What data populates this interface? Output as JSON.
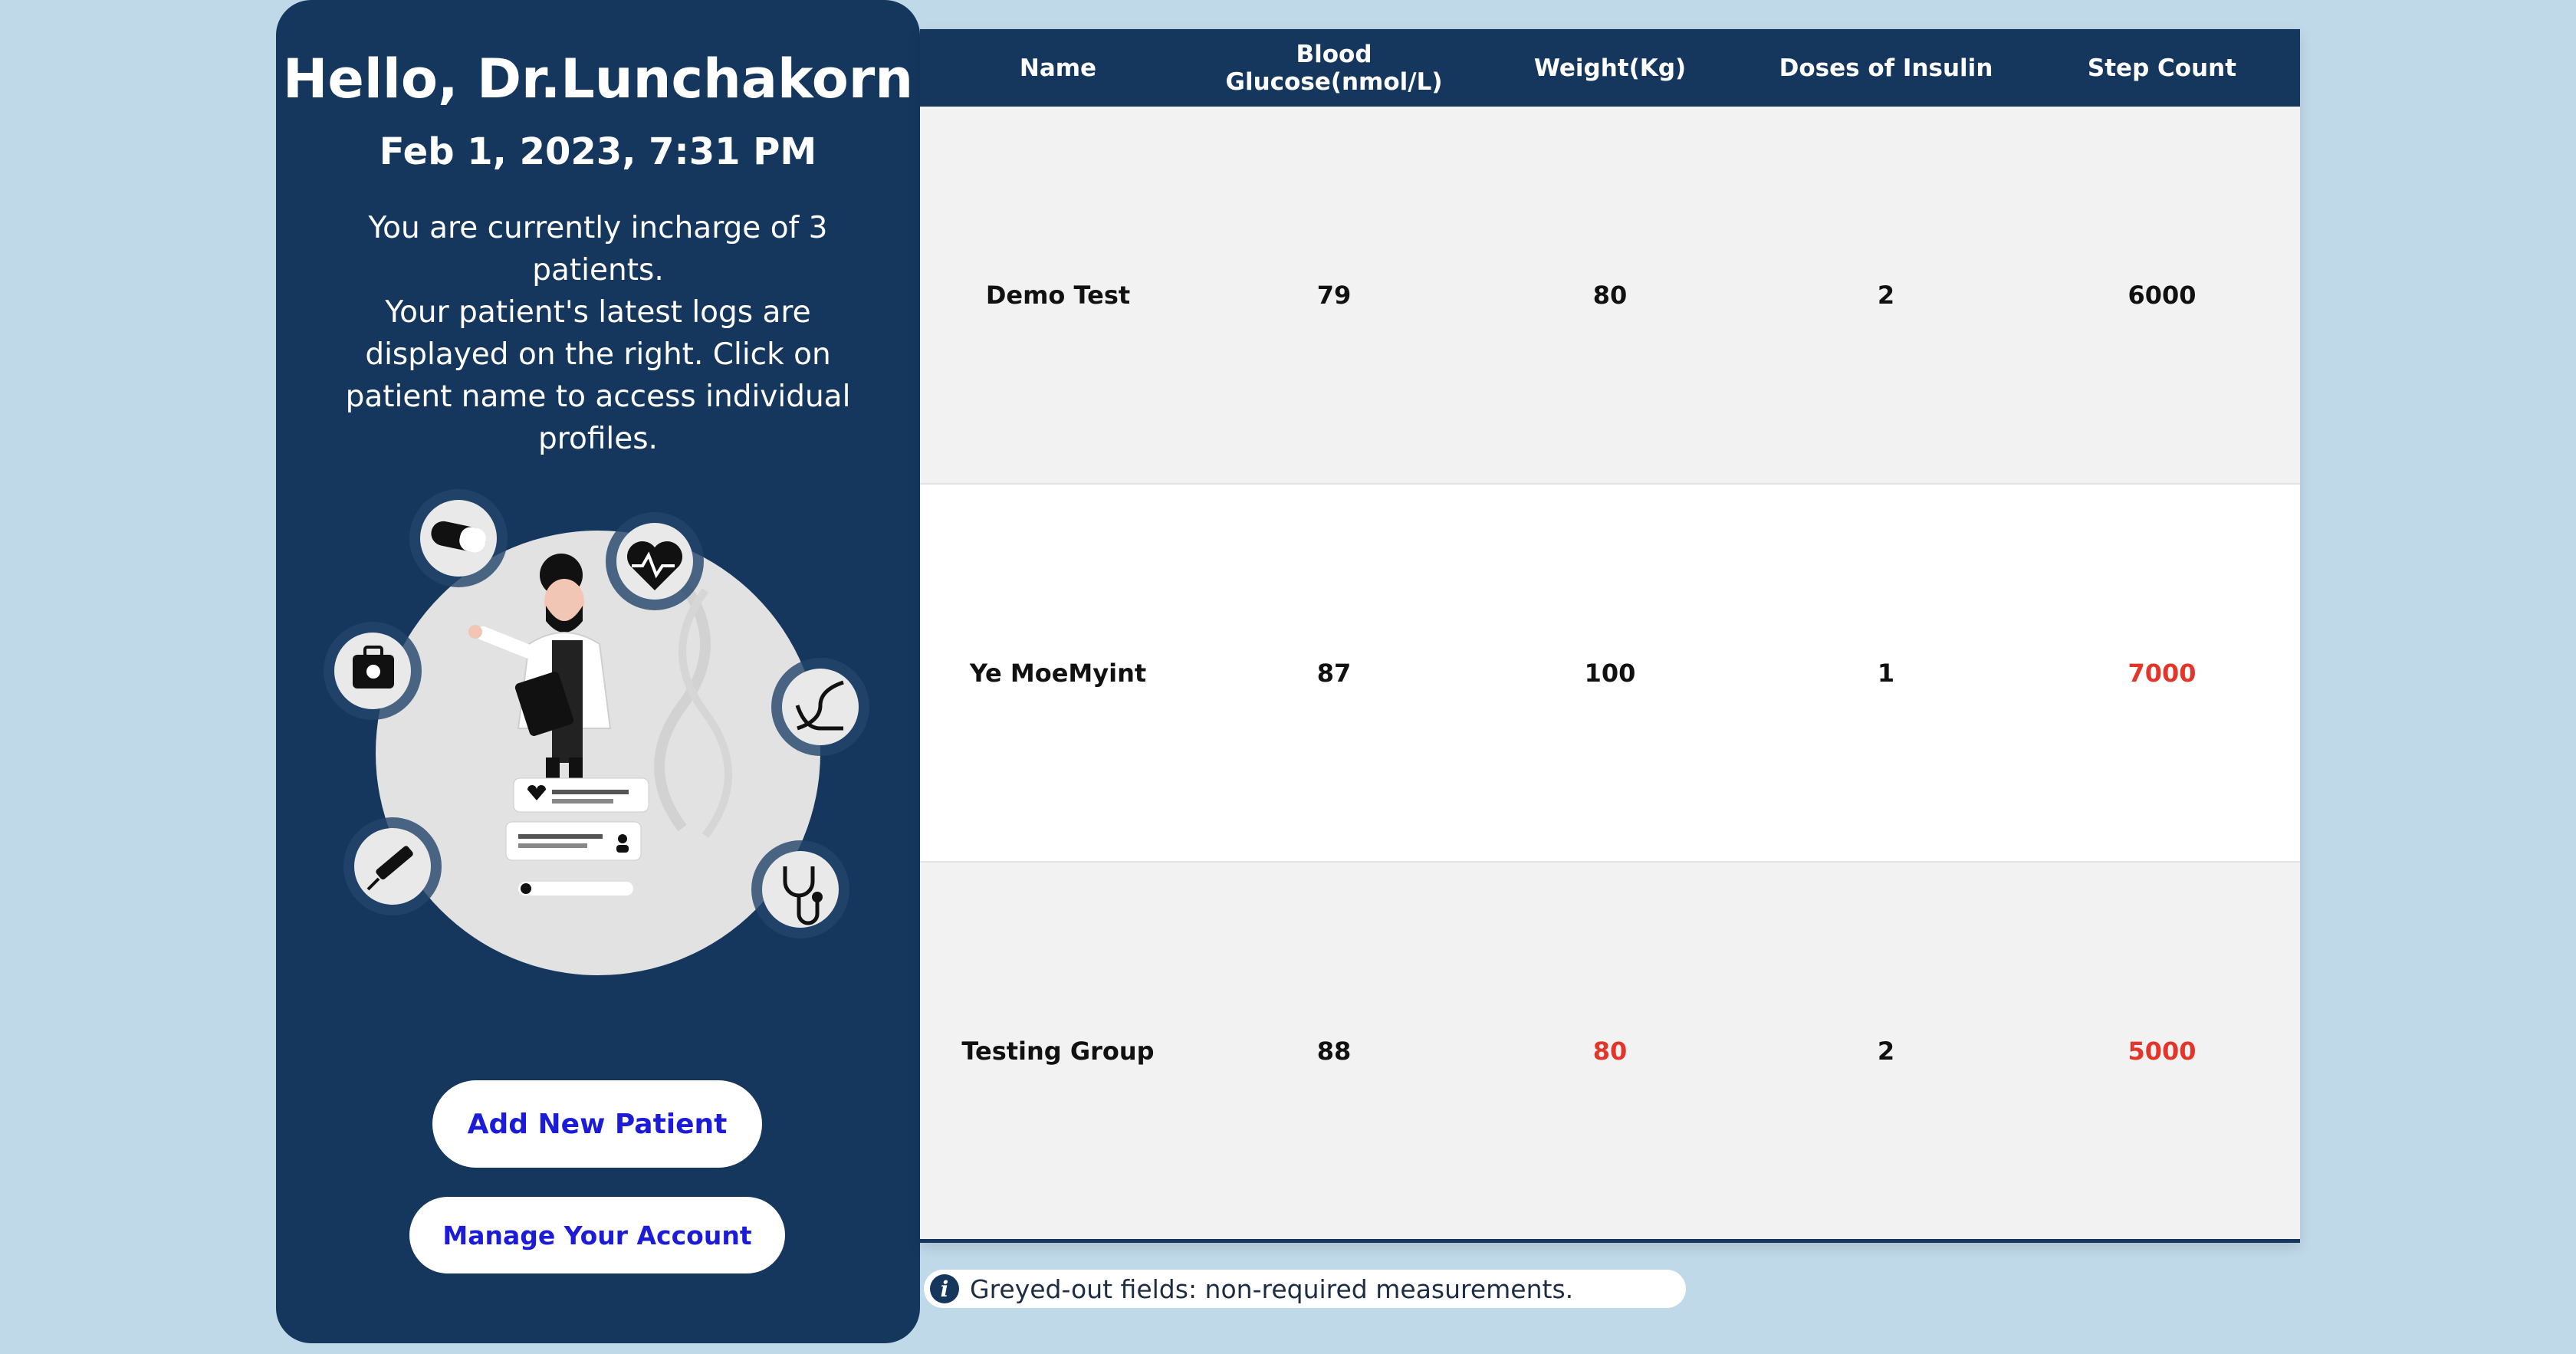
{
  "sidebar": {
    "greeting": "Hello, Dr.Lunchakorn",
    "datetime": "Feb 1, 2023, 7:31 PM",
    "description_line1": "You are currently incharge of 3 patients.",
    "description_line2": "Your patient's latest logs are displayed on the right. Click on patient name to access individual profiles.",
    "add_patient_label": "Add New Patient",
    "manage_account_label": "Manage Your Account"
  },
  "table": {
    "headers": [
      "Name",
      "Blood Glucose(nmol/L)",
      "Weight(Kg)",
      "Doses of Insulin",
      "Step Count"
    ],
    "rows": [
      {
        "name": "Demo Test",
        "glucose": "79",
        "weight": "80",
        "insulin": "2",
        "steps": "6000"
      },
      {
        "name": "Ye MoeMyint",
        "glucose": "87",
        "weight": "100",
        "insulin": "1",
        "steps": "7000"
      },
      {
        "name": "Testing Group",
        "glucose": "88",
        "weight": "80",
        "insulin": "2",
        "steps": "5000"
      }
    ]
  },
  "note": {
    "icon": "info-icon",
    "text": "Greyed-out fields: non-required measurements."
  },
  "colors": {
    "navy": "#15375e",
    "background": "#c0d9e9",
    "button_text": "#1b1bd8",
    "alert": "#e2362b"
  }
}
